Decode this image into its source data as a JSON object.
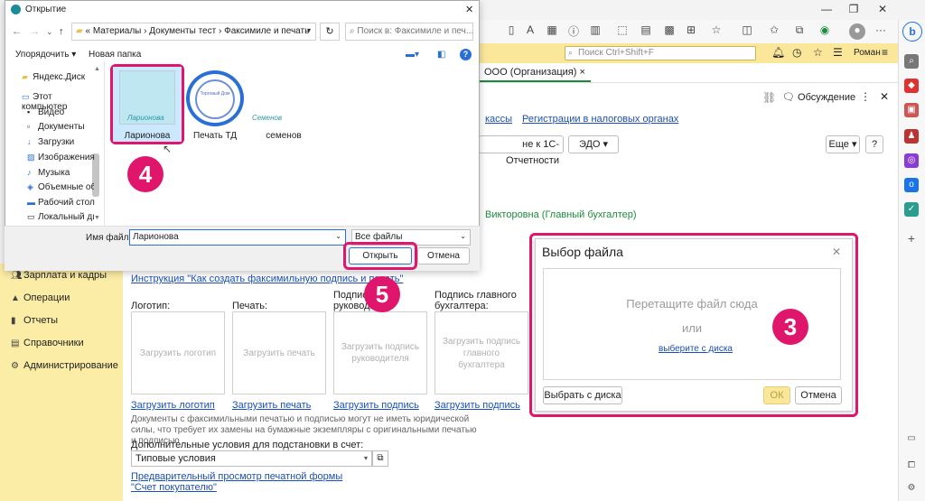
{
  "browser": {
    "search_placeholder": "Поиск Ctrl+Shift+F",
    "user_name": "Роман",
    "tab_label": "ООО (Организация)",
    "tab_close": "×"
  },
  "dialog": {
    "title": "Открытие",
    "path": [
      "Материалы",
      "Документы тест",
      "Факсимиле и печать"
    ],
    "path_prefix": "«",
    "search_placeholder": "Поиск в: Факсимиле и печ...",
    "organize_label": "Упорядочить ▾",
    "new_folder_label": "Новая папка",
    "nav_items": [
      {
        "label": "Яндекс.Диск",
        "icon": "folder-icon"
      },
      {
        "label": "Этот компьютер",
        "icon": "computer-icon"
      },
      {
        "label": "Видео",
        "icon": "video-icon"
      },
      {
        "label": "Документы",
        "icon": "documents-icon"
      },
      {
        "label": "Загрузки",
        "icon": "downloads-icon"
      },
      {
        "label": "Изображения",
        "icon": "images-icon"
      },
      {
        "label": "Музыка",
        "icon": "music-icon"
      },
      {
        "label": "Объемные объ",
        "icon": "3d-icon"
      },
      {
        "label": "Рабочий стол",
        "icon": "desktop-icon"
      },
      {
        "label": "Локальный дис",
        "icon": "disk-icon"
      }
    ],
    "files": [
      {
        "name": "Ларионова",
        "thumb_text": "Ларионова"
      },
      {
        "name": "Печать ТД",
        "thumb_text": "Торговый Дом"
      },
      {
        "name": "семенов",
        "thumb_text": "Семенов"
      }
    ],
    "filename_label": "Имя файла:",
    "filename_value": "Ларионова",
    "filetype_value": "Все файлы",
    "open_label": "Открыть",
    "cancel_label": "Отмена"
  },
  "page": {
    "header_discuss": "Обсуждение",
    "links_top": [
      "кассы",
      "Регистрации в налоговых органах"
    ],
    "btn_1c": "не к 1С-Отчетности",
    "btn_edo": "ЭДО ▾",
    "btn_more": "Еще ▾",
    "btn_help": "?",
    "accountant": "Викторовна (Главный бухгалтер)",
    "instruction_link": "Инструкция \"Как создать факсимильную подпись и печать\"",
    "slots": [
      {
        "label": "Логотип:",
        "placeholder": "Загрузить логотип",
        "link": "Загрузить логотип"
      },
      {
        "label": "Печать:",
        "placeholder": "Загрузить печать",
        "link": "Загрузить печать"
      },
      {
        "label": "Подпись руководителя:",
        "label_visible": "Подпись\nруководи",
        "placeholder": "Загрузить подпись руководителя",
        "link": "Загрузить подпись"
      },
      {
        "label": "Подпись главного бухгалтера:",
        "placeholder": "Загрузить подпись главного бухгалтера",
        "link": "Загрузить подпись"
      }
    ],
    "note": "Документы с факсимильными печатью и подписью могут не иметь юридической силы, что требует их замены на бумажные экземпляры с оригинальными печатью и подписью",
    "extra_label": "Дополнительные условия для подстановки в счет:",
    "extra_value": "Типовые условия",
    "preview_link": "Предварительный просмотр печатной формы \"Счет покупателю\""
  },
  "sidebar": {
    "items": [
      {
        "label": "Зарплата и кадры",
        "icon": "users-icon"
      },
      {
        "label": "Операции",
        "icon": "operations-icon"
      },
      {
        "label": "Отчеты",
        "icon": "reports-icon"
      },
      {
        "label": "Справочники",
        "icon": "book-icon"
      },
      {
        "label": "Администрирование",
        "icon": "gear-icon"
      }
    ]
  },
  "file_picker": {
    "title": "Выбор файла",
    "drop_text": "Перетащите файл сюда",
    "or_text": "или",
    "choose_link": "выберите с диска",
    "choose_btn": "Выбрать с диска",
    "ok_label": "ОК",
    "cancel_label": "Отмена"
  },
  "callouts": [
    "3",
    "4",
    "5"
  ]
}
